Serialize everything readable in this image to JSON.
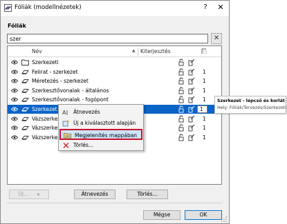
{
  "window": {
    "title": "Fóliák (modellnézetek)",
    "help_symbol": "?",
    "close_symbol": "✕"
  },
  "section_label": "Fóliák",
  "search": {
    "value": "szer",
    "clear_symbol": "✕"
  },
  "list": {
    "columns": {
      "name": "Név",
      "sort_indicator": "▲",
      "extension": "Kiterjesztés"
    },
    "rows": [
      {
        "name": "Szerkezeti",
        "icon": "folder-icon",
        "num": "",
        "selected": false
      },
      {
        "name": "Felirat - szerkezet",
        "icon": "layer-icon",
        "num": "1",
        "selected": false
      },
      {
        "name": "Méretezés - szerkezet",
        "icon": "layer-icon",
        "num": "1",
        "selected": false
      },
      {
        "name": "Szerkesztővonalak - általános",
        "icon": "layer-icon",
        "num": "1",
        "selected": false
      },
      {
        "name": "Szerkesztővonalak - fogópont",
        "icon": "layer-icon",
        "num": "1",
        "selected": false
      },
      {
        "name": "Szerkezet - lépcső és korlát",
        "icon": "layer-icon",
        "num": "1",
        "selected": true
      },
      {
        "name": "Vázszerkezet",
        "icon": "layer-icon",
        "num": "1",
        "selected": false
      },
      {
        "name": "Vázszerkezet",
        "icon": "layer-icon",
        "num": "1",
        "selected": false
      },
      {
        "name": "Vázszerkezet",
        "icon": "layer-icon",
        "num": "1",
        "selected": false
      }
    ]
  },
  "context_menu": {
    "items": [
      {
        "label": "Átnevezés",
        "icon": "rename-icon",
        "highlighted": false
      },
      {
        "label": "Új a kiválasztott alapján",
        "icon": "new-from-selected-icon",
        "highlighted": false
      },
      {
        "label": "Megjelenítés mappában",
        "icon": "show-in-folder-icon",
        "highlighted": true
      },
      {
        "label": "Törlés...",
        "icon": "delete-x-icon",
        "highlighted": false
      }
    ]
  },
  "tooltip": {
    "title": "Szerkezet - lépcső és korlát",
    "path": "Hely: Fóliák/Tervezés/Szerkezeti"
  },
  "buttons": {
    "new": "Új...",
    "new_arrow": "▼",
    "rename": "Átnevezés",
    "delete": "Törlés...",
    "cancel": "Mégse",
    "ok": "OK"
  },
  "colors": {
    "selection": "#0a64c8",
    "highlight_border": "#c8102e",
    "menu_highlight": "#cde4f9"
  }
}
